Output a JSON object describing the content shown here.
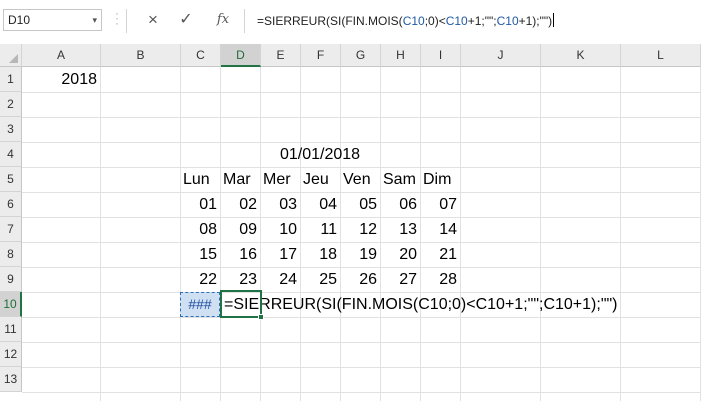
{
  "formula_bar": {
    "name_box": "D10",
    "name_box_arrow": "▾",
    "cancel_icon": "×",
    "enter_icon": "✓",
    "fx_icon": "fx",
    "formula_parts": [
      "=SIERREUR(SI(FIN.MOIS(",
      "C10",
      ";0)<",
      "C10",
      "+1;\"\";",
      "C10",
      "+1);\"\")"
    ]
  },
  "columns": [
    "A",
    "B",
    "C",
    "D",
    "E",
    "F",
    "G",
    "H",
    "I",
    "J",
    "K",
    "L"
  ],
  "active_column": "D",
  "rows": [
    "1",
    "2",
    "3",
    "4",
    "5",
    "6",
    "7",
    "8",
    "9",
    "10",
    "11",
    "12",
    "13"
  ],
  "active_row": "10",
  "cells": {
    "A1": "2018",
    "C4": "01/01/2018",
    "weekday_headers": [
      "Lun",
      "Mar",
      "Mer",
      "Jeu",
      "Ven",
      "Sam",
      "Dim"
    ],
    "weeks": [
      [
        "01",
        "02",
        "03",
        "04",
        "05",
        "06",
        "07"
      ],
      [
        "08",
        "09",
        "10",
        "11",
        "12",
        "13",
        "14"
      ],
      [
        "15",
        "16",
        "17",
        "18",
        "19",
        "20",
        "21"
      ],
      [
        "22",
        "23",
        "24",
        "25",
        "26",
        "27",
        "28"
      ]
    ],
    "C10": "###",
    "D10": "=SIERREUR(SI(FIN.MOIS(C10;0)<C10+1;\"\";C10+1);\"\")"
  },
  "colors": {
    "excel_green": "#217346",
    "reference_blue": "#1f5aa6",
    "reference_highlight": "#cfe0f3"
  }
}
